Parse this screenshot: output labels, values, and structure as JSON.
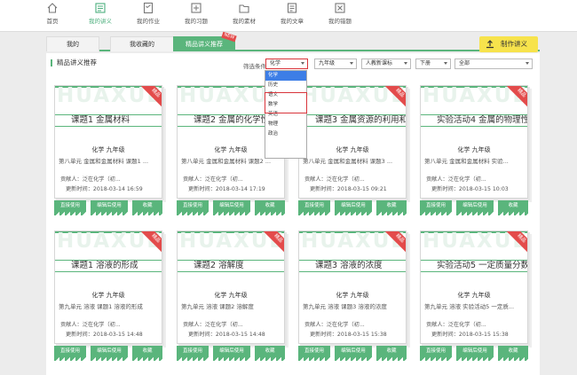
{
  "nav": [
    {
      "label": "首页",
      "icon": "home-icon"
    },
    {
      "label": "我的讲义",
      "icon": "handout-icon",
      "active": true
    },
    {
      "label": "我的作业",
      "icon": "homework-icon"
    },
    {
      "label": "我的习题",
      "icon": "exercise-icon"
    },
    {
      "label": "我的素材",
      "icon": "material-icon"
    },
    {
      "label": "我的文章",
      "icon": "article-icon"
    },
    {
      "label": "我的错题",
      "icon": "mistake-icon"
    }
  ],
  "tabs": [
    {
      "label": "我的"
    },
    {
      "label": "我收藏的"
    },
    {
      "label": "精品讲义推荐",
      "active": true,
      "badge": "NEW"
    }
  ],
  "make_button": "制作讲义",
  "section_title": "精品讲义推荐",
  "filters": {
    "label": "筛选条件：",
    "subject": "化学",
    "grade": "九年级",
    "edition": "人教新课标",
    "term": "下册",
    "scope": "全部"
  },
  "subject_options": [
    "化学",
    "历史",
    "语文",
    "数学",
    "英语",
    "物理",
    "政治"
  ],
  "cards_row1": [
    {
      "title": "课题1 金属材料",
      "subject": "化学  九年级",
      "chapter": "第八单元 金属和金属材料  课题1 ...",
      "author": "贡献人：泛在化学（初...",
      "time": "更新时间：2018-03-14 16:59",
      "badge": "精品"
    },
    {
      "title": "课题2 金属的化学性",
      "subject": "化学  九年级",
      "chapter": "第八单元 金属和金属材料  课题2 ...",
      "author": "贡献人：泛在化学（初...",
      "time": "更新时间：2018-03-14 17:19",
      "badge": "精品"
    },
    {
      "title": "课题3 金属资源的利用和...",
      "subject": "化学  九年级",
      "chapter": "第八单元 金属和金属材料  课题3 ...",
      "author": "贡献人：泛在化学（初...",
      "time": "更新时间：2018-03-15 09:21",
      "badge": "精品"
    },
    {
      "title": "实验活动4 金属的物理性...",
      "subject": "化学  九年级",
      "chapter": "第八单元 金属和金属材料  实验...",
      "author": "贡献人：泛在化学（初...",
      "time": "更新时间：2018-03-15 10:03",
      "badge": "精品"
    }
  ],
  "cards_row2": [
    {
      "title": "课题1 溶液的形成",
      "subject": "化学  九年级",
      "chapter": "第九单元 溶液  课题1 溶液的形成",
      "author": "贡献人：泛在化学（初...",
      "time": "更新时间：2018-03-15 14:48",
      "badge": "精品"
    },
    {
      "title": "课题2 溶解度",
      "subject": "化学  九年级",
      "chapter": "第九单元 溶液  课题2 溶解度",
      "author": "贡献人：泛在化学（初...",
      "time": "更新时间：2018-03-15 14:48",
      "badge": "精品"
    },
    {
      "title": "课题3 溶液的浓度",
      "subject": "化学  九年级",
      "chapter": "第九单元 溶液  课题3 溶液的浓度",
      "author": "贡献人：泛在化学（初...",
      "time": "更新时间：2018-03-15 15:38",
      "badge": "精品"
    },
    {
      "title": "实验活动5 一定质量分数...",
      "subject": "化学  九年级",
      "chapter": "第九单元 溶液  实验活动5 一定质...",
      "author": "贡献人：泛在化学（初...",
      "time": "更新时间：2018-03-15 15:38",
      "badge": "精品"
    }
  ],
  "watermark": "HUAXUE",
  "actions": {
    "direct": "直接使用",
    "edit": "编辑后使用",
    "fav": "收藏"
  }
}
